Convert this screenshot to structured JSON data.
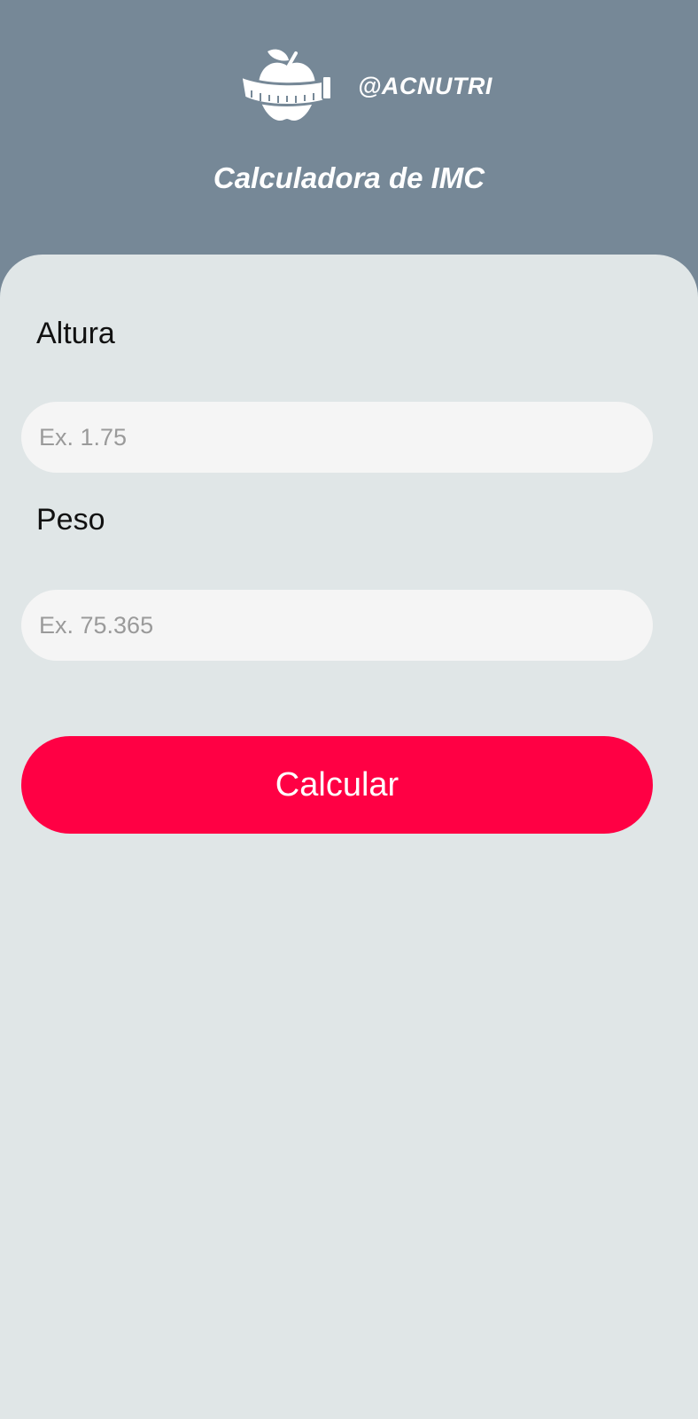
{
  "header": {
    "logo_icon": "apple-measuring-tape-icon",
    "handle": "@ACNUTRI",
    "title": "Calculadora de IMC"
  },
  "form": {
    "altura_label": "Altura",
    "altura_placeholder": "Ex. 1.75",
    "altura_value": "",
    "peso_label": "Peso",
    "peso_placeholder": "Ex. 75.365",
    "peso_value": "",
    "submit_label": "Calcular"
  },
  "colors": {
    "header_bg": "#768897",
    "panel_bg": "#e0e6e7",
    "field_bg": "#f5f5f5",
    "button_bg": "#ff0044"
  }
}
